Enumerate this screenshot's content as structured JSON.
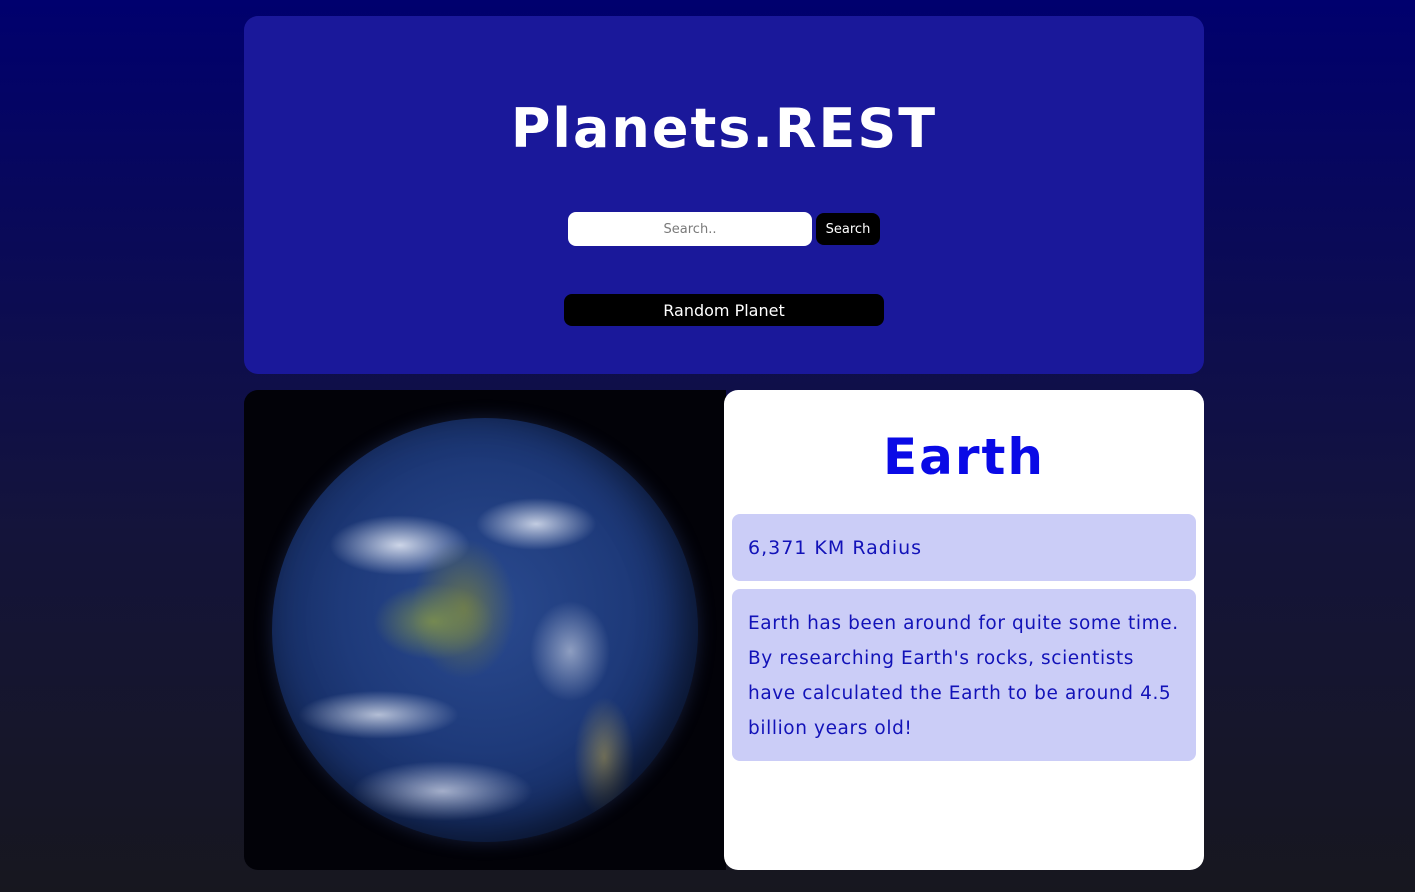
{
  "header": {
    "title": "Planets.REST",
    "search": {
      "placeholder": "Search..",
      "value": "",
      "button_label": "Search"
    },
    "random_button_label": "Random Planet"
  },
  "planet": {
    "name": "Earth",
    "radius_text": "6,371 KM Radius",
    "description": "Earth has been around for quite some time. By researching Earth's rocks, scientists have calculated the Earth to be around 4.5 billion years old!",
    "image_icon": "earth-globe-image"
  },
  "colors": {
    "header_bg": "#1a189a",
    "button_bg": "#000000",
    "planet_name": "#0a0ae6",
    "info_box_bg": "#cbcdf7",
    "info_text": "#1212b8"
  }
}
